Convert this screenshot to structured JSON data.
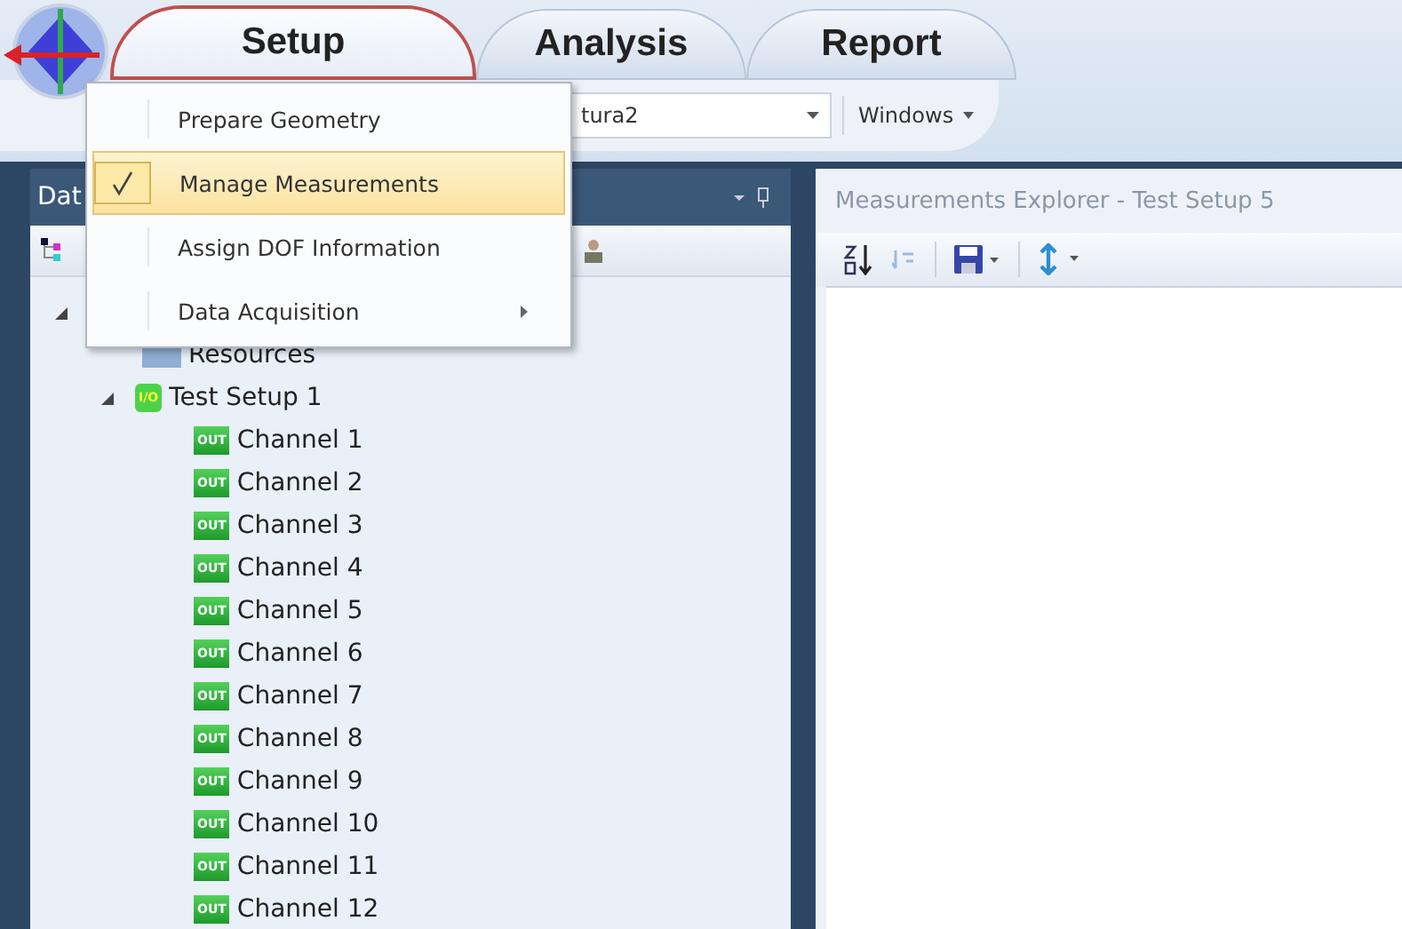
{
  "tabs": [
    {
      "label": "Setup",
      "selected": true
    },
    {
      "label": "Analysis",
      "selected": false
    },
    {
      "label": "Report",
      "selected": false
    }
  ],
  "ribbon": {
    "dropdown_value": "tura2",
    "windows_button": "Windows"
  },
  "menu": [
    {
      "label": "Prepare Geometry",
      "checked": false,
      "submenu": false
    },
    {
      "label": "Manage Measurements",
      "checked": true,
      "submenu": false
    },
    {
      "label": "Assign DOF Information",
      "checked": false,
      "submenu": false
    },
    {
      "label": "Data Acquisition",
      "checked": false,
      "submenu": true
    }
  ],
  "left_panel": {
    "title": "Dat",
    "root_expanded": true,
    "tree": [
      {
        "label": "Resources",
        "kind": "folder"
      },
      {
        "label": "Test Setup 1",
        "kind": "setup",
        "badge": "I/O",
        "expanded": true,
        "children": [
          {
            "label": "Channel 1",
            "badge": "OUT"
          },
          {
            "label": "Channel 2",
            "badge": "OUT"
          },
          {
            "label": "Channel 3",
            "badge": "OUT"
          },
          {
            "label": "Channel 4",
            "badge": "OUT"
          },
          {
            "label": "Channel 5",
            "badge": "OUT"
          },
          {
            "label": "Channel 6",
            "badge": "OUT"
          },
          {
            "label": "Channel 7",
            "badge": "OUT"
          },
          {
            "label": "Channel 8",
            "badge": "OUT"
          },
          {
            "label": "Channel 9",
            "badge": "OUT"
          },
          {
            "label": "Channel 10",
            "badge": "OUT"
          },
          {
            "label": "Channel 11",
            "badge": "OUT"
          },
          {
            "label": "Channel 12",
            "badge": "OUT"
          }
        ]
      }
    ]
  },
  "right_panel": {
    "title": "Measurements Explorer - Test Setup 5"
  }
}
